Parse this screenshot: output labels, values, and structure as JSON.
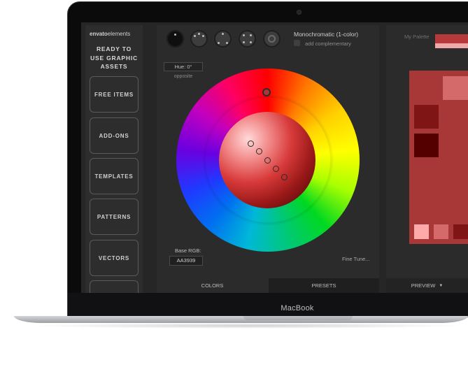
{
  "device": {
    "brand": "MacBook"
  },
  "sidebar": {
    "logo": {
      "prefix": "envato",
      "suffix": "elements"
    },
    "tagline": [
      "READY TO",
      "USE GRAPHIC",
      "ASSETS"
    ],
    "items": [
      {
        "label": "FREE ITEMS"
      },
      {
        "label": "ADD-ONS"
      },
      {
        "label": "TEMPLATES"
      },
      {
        "label": "PATTERNS"
      },
      {
        "label": "VECTORS"
      }
    ]
  },
  "toolbar": {
    "mode_title": "Monochromatic (1-color)",
    "add_complementary": "add complementary"
  },
  "hue": {
    "value": "Hue: 0°",
    "opposite": "opposite"
  },
  "base_rgb": {
    "label": "Base RGB:",
    "value": "AA3939"
  },
  "fine_tune": "Fine Tune...",
  "tabs": {
    "colors": "COLORS",
    "presets": "PRESETS",
    "preview": "PREVIEW"
  },
  "palette": {
    "label": "My Palette"
  },
  "colors": {
    "base": "#AA3939",
    "swatch_dark": "#801515",
    "swatch_darker": "#550000",
    "swatch_light": "#D46A6A",
    "swatch_lighter": "#FFAAAA"
  }
}
